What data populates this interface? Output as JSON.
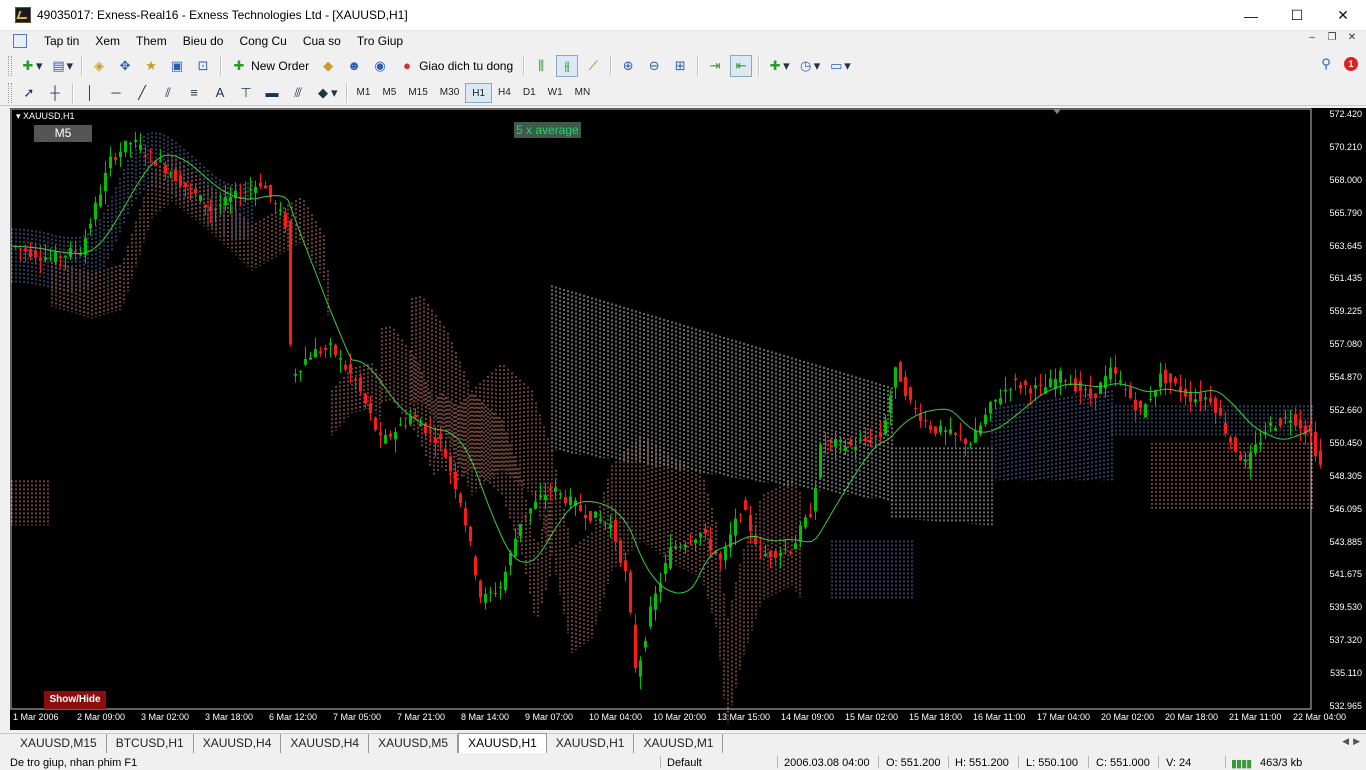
{
  "window": {
    "title": "49035017: Exness-Real16 - Exness Technologies Ltd - [XAUUSD,H1]",
    "minimize_glyph": "—",
    "maximize_glyph": "☐",
    "close_glyph": "✕"
  },
  "menu": [
    "Tap tin",
    "Xem",
    "Them",
    "Bieu do",
    "Cong Cu",
    "Cua so",
    "Tro Giup"
  ],
  "toolbar": {
    "new_order_label": "New Order",
    "autotrade_label": "Giao dich tu dong",
    "notification_count": "1"
  },
  "timeframes": [
    "M1",
    "M5",
    "M15",
    "M30",
    "H1",
    "H4",
    "D1",
    "W1",
    "MN"
  ],
  "active_timeframe": "H1",
  "chart": {
    "symbol_label": "XAUUSD,H1",
    "badge": "M5",
    "indicator_label": "5 x average",
    "show_hide": "Show/Hide",
    "price_ticks": [
      "572.420",
      "570.210",
      "568.000",
      "565.790",
      "563.645",
      "561.435",
      "559.225",
      "557.080",
      "554.870",
      "552.660",
      "550.450",
      "548.305",
      "546.095",
      "543.885",
      "541.675",
      "539.530",
      "537.320",
      "535.110",
      "532.965"
    ],
    "time_ticks": [
      "1 Mar 2006",
      "2 Mar 09:00",
      "3 Mar 02:00",
      "3 Mar 18:00",
      "6 Mar 12:00",
      "7 Mar 05:00",
      "7 Mar 21:00",
      "8 Mar 14:00",
      "9 Mar 07:00",
      "10 Mar 04:00",
      "10 Mar 20:00",
      "13 Mar 15:00",
      "14 Mar 09:00",
      "15 Mar 02:00",
      "15 Mar 18:00",
      "16 Mar 11:00",
      "17 Mar 04:00",
      "20 Mar 02:00",
      "20 Mar 18:00",
      "21 Mar 11:00",
      "22 Mar 04:00"
    ],
    "colors": {
      "bull": "#00c000",
      "bear": "#ff1a1a",
      "kumo_up": "#6f8fd8",
      "kumo_down": "#ff9a8a",
      "kumo_white": "#ffffff",
      "ma": "#3ccc3c",
      "background": "#000000"
    }
  },
  "tabs": [
    "XAUUSD,M15",
    "BTCUSD,H1",
    "XAUUSD,H4",
    "XAUUSD,H4",
    "XAUUSD,M5",
    "XAUUSD,H1",
    "XAUUSD,H1",
    "XAUUSD,M1"
  ],
  "active_tab_index": 5,
  "status": {
    "help": "De tro giup, nhan phim F1",
    "profile": "Default",
    "datetime": "2006.03.08 04:00",
    "open": "O: 551.200",
    "high": "H: 551.200",
    "low": "L: 550.100",
    "close": "C: 551.000",
    "volume": "V: 24",
    "traffic": "463/3 kb"
  }
}
